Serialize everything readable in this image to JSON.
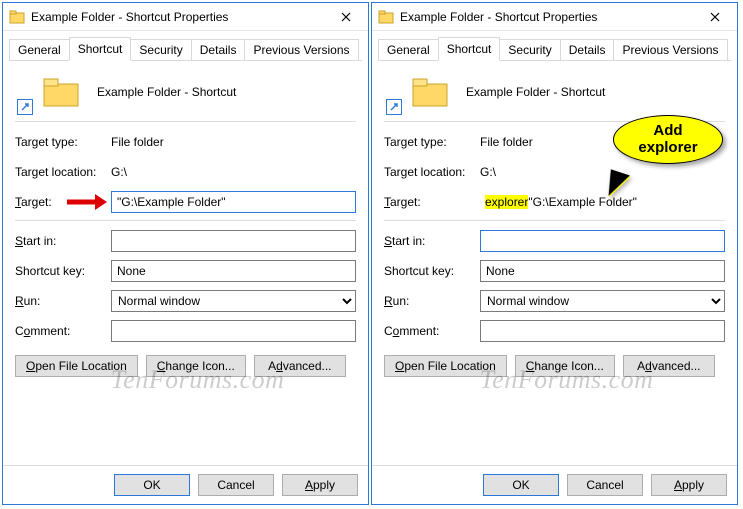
{
  "windows": [
    {
      "title": "Example Folder - Shortcut Properties",
      "tabs": [
        "General",
        "Shortcut",
        "Security",
        "Details",
        "Previous Versions"
      ],
      "active_tab": "Shortcut",
      "header": "Example Folder - Shortcut",
      "target_type_label": "Target type:",
      "target_type_value": "File folder",
      "target_location_label": "Target location:",
      "target_location_value": "G:\\",
      "target_label": "Target:",
      "target_value": "\"G:\\Example Folder\"",
      "target_prefix": "",
      "start_in_label": "Start in:",
      "start_in_value": "",
      "shortcut_key_label": "Shortcut key:",
      "shortcut_key_value": "None",
      "run_label": "Run:",
      "run_value": "Normal window",
      "comment_label": "Comment:",
      "comment_value": "",
      "btn_open": "Open File Location",
      "btn_change": "Change Icon...",
      "btn_advanced": "Advanced...",
      "ok": "OK",
      "cancel": "Cancel",
      "apply": "Apply",
      "annotation": {
        "type": "red-arrow"
      }
    },
    {
      "title": "Example Folder - Shortcut Properties",
      "tabs": [
        "General",
        "Shortcut",
        "Security",
        "Details",
        "Previous Versions"
      ],
      "active_tab": "Shortcut",
      "header": "Example Folder - Shortcut",
      "target_type_label": "Target type:",
      "target_type_value": "File folder",
      "target_location_label": "Target location:",
      "target_location_value": "G:\\",
      "target_label": "Target:",
      "target_value": "\"G:\\Example Folder\"",
      "target_prefix": "explorer ",
      "start_in_label": "Start in:",
      "start_in_value": "",
      "shortcut_key_label": "Shortcut key:",
      "shortcut_key_value": "None",
      "run_label": "Run:",
      "run_value": "Normal window",
      "comment_label": "Comment:",
      "comment_value": "",
      "btn_open": "Open File Location",
      "btn_change": "Change Icon...",
      "btn_advanced": "Advanced...",
      "ok": "OK",
      "cancel": "Cancel",
      "apply": "Apply",
      "annotation": {
        "type": "callout",
        "text_line1": "Add",
        "text_line2": "explorer"
      }
    }
  ],
  "watermark": "TenForums.com"
}
